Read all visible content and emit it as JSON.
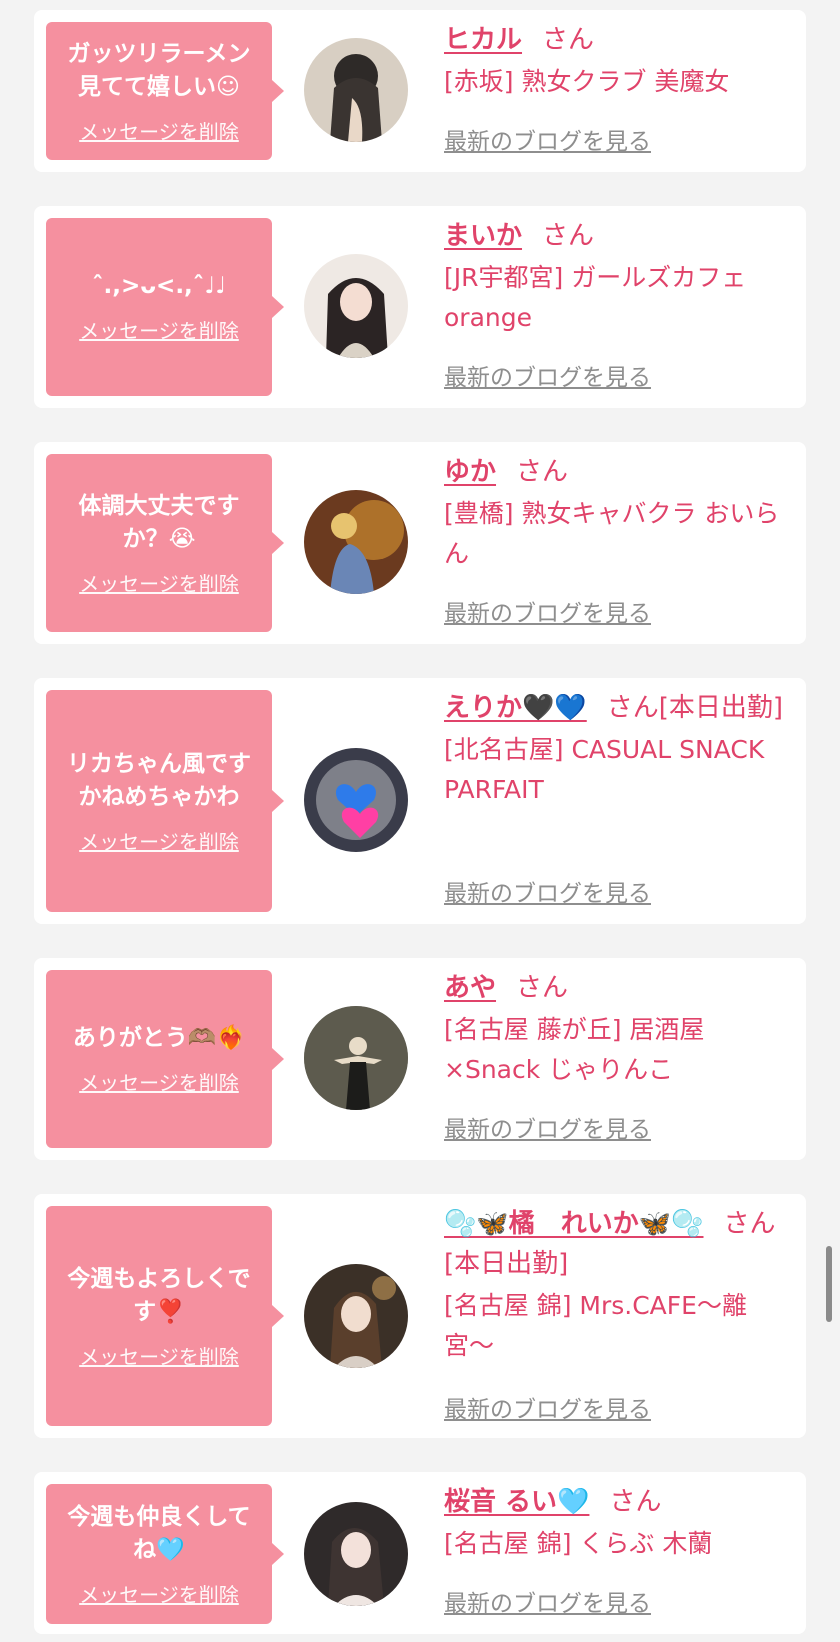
{
  "delete_label": "メッセージを削除",
  "blog_label": "最新のブログを見る",
  "san_label": "さん",
  "cards": [
    {
      "message": "ガッツリラーメン\n見てて嬉しい☺",
      "name": "ヒカル",
      "suffix": "",
      "shop": "[赤坂] 熟女クラブ 美魔女"
    },
    {
      "message": "ˆ.,>ᴗ<.,ˆ♩♩",
      "name": "まいか",
      "suffix": "",
      "shop": "[JR宇都宮] ガールズカフェ orange"
    },
    {
      "message": "体調大丈夫です\nか？😭",
      "name": "ゆか",
      "suffix": "",
      "shop": "[豊橋] 熟女キャバクラ おいらん"
    },
    {
      "message": "リカちゃん風です\nかねめちゃかわ",
      "name": "えりか🖤💙",
      "suffix": "[本日出勤]",
      "shop": "[北名古屋] CASUAL SNACK PARFAIT"
    },
    {
      "message": "ありがとう🫶🏽❤️‍🔥",
      "name": "あや",
      "suffix": "",
      "shop": "[名古屋 藤が丘] 居酒屋×Snack じゃりんこ"
    },
    {
      "message": "今週もよろしくで\nす❣️",
      "name": "🫧🦋橘　れいか🦋🫧",
      "suffix": "[本日出勤]",
      "shop": "[名古屋 錦] Mrs.CAFE〜離宮〜"
    },
    {
      "message": "今週も仲良くして\nね🩵",
      "name": "桜音 るい🩵",
      "suffix": "",
      "shop": "[名古屋 錦] くらぶ 木蘭"
    }
  ],
  "colors": {
    "accent": "#e0436a",
    "bubble": "#f5909f",
    "link_gray": "#8e8e8e",
    "background": "#f3f3f3"
  }
}
